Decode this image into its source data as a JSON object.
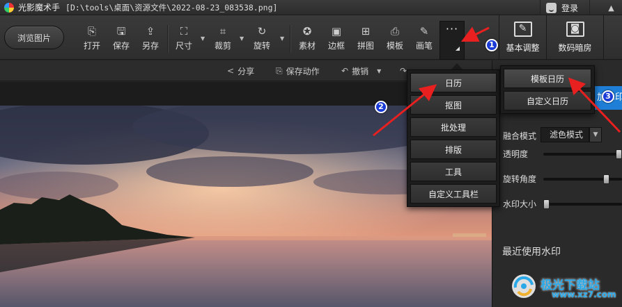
{
  "titlebar": {
    "app_name": "光影魔术手",
    "file_path": "[D:\\tools\\桌面\\资源文件\\2022-08-23_083538.png]",
    "login_label": "登录",
    "collapse_icon": "chevron-up"
  },
  "toolbar": {
    "browse_label": "浏览图片",
    "tools": [
      {
        "icon": "open-icon",
        "label": "打开"
      },
      {
        "icon": "save-icon",
        "label": "保存"
      },
      {
        "icon": "save-as-icon",
        "label": "另存"
      },
      {
        "icon": "size-icon",
        "label": "尺寸"
      },
      {
        "icon": "crop-icon",
        "label": "裁剪"
      },
      {
        "icon": "rotate-icon",
        "label": "旋转"
      },
      {
        "icon": "material-icon",
        "label": "素材"
      },
      {
        "icon": "border-icon",
        "label": "边框"
      },
      {
        "icon": "collage-icon",
        "label": "拼图"
      },
      {
        "icon": "template-icon",
        "label": "模板"
      },
      {
        "icon": "brush-icon",
        "label": "画笔"
      }
    ],
    "more_label": "···",
    "right_tabs": [
      {
        "icon": "edit-icon",
        "label": "基本调整"
      },
      {
        "icon": "camera-icon",
        "label": "数码暗房"
      }
    ]
  },
  "secbar": {
    "share": "分享",
    "save_action": "保存动作",
    "undo": "撤销"
  },
  "more_menu": {
    "items": [
      "日历",
      "抠图",
      "批处理",
      "排版",
      "工具",
      "自定义工具栏"
    ]
  },
  "calendar_menu": {
    "items": [
      "模板日历",
      "自定义日历"
    ]
  },
  "right_panel": {
    "tab_partial": "加水印",
    "blend_label": "融合模式",
    "blend_value": "滤色模式",
    "opacity_label": "透明度",
    "rotate_label": "旋转角度",
    "size_label": "水印大小",
    "recent_label": "最近使用水印"
  },
  "annotations": {
    "badges": [
      "1",
      "2",
      "3"
    ],
    "arrow_color": "#e8201f"
  },
  "watermark": {
    "text": "极光下载站",
    "url": "www.xz7.com"
  },
  "colors": {
    "accent_blue": "#1f7ed6",
    "badge_blue": "#1a3bd6"
  }
}
